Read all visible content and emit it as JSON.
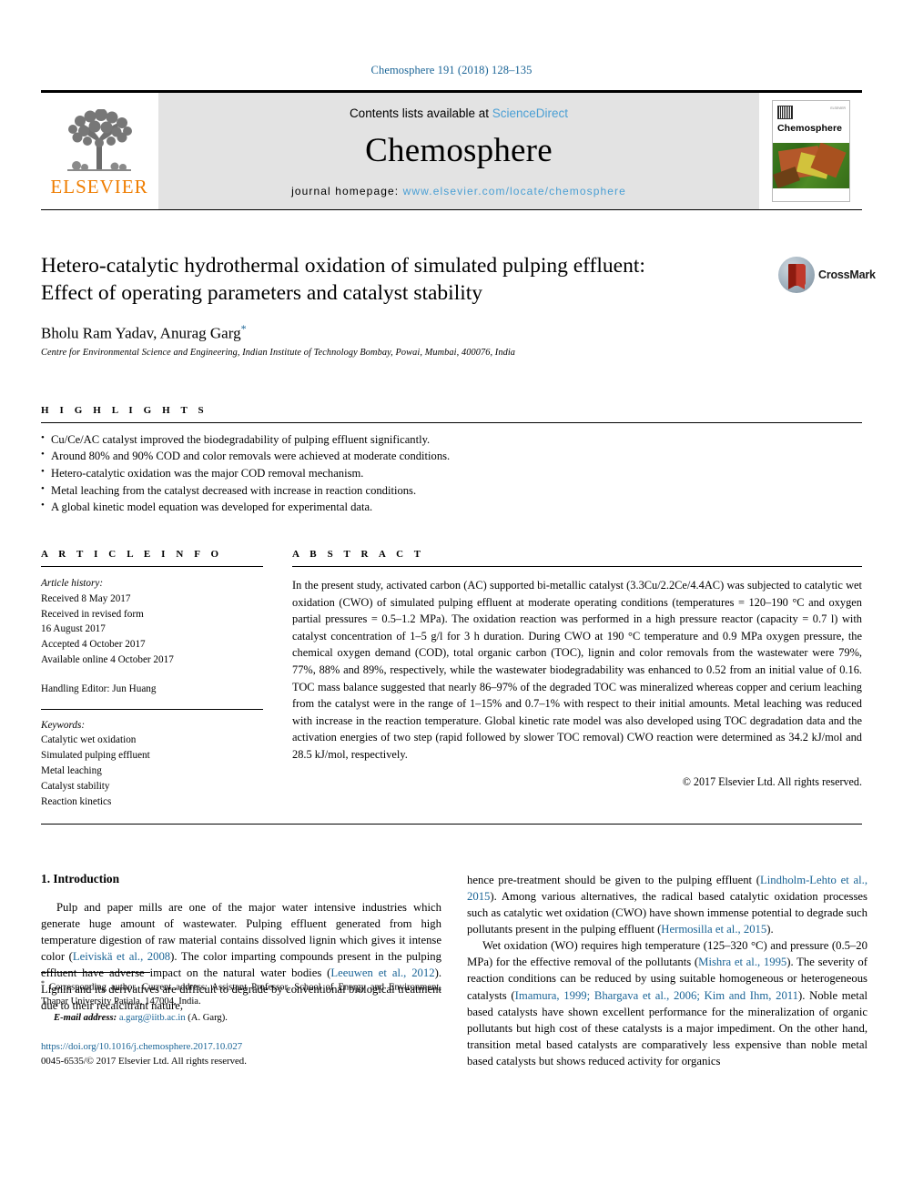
{
  "running_head": "Chemosphere 191 (2018) 128–135",
  "masthead": {
    "publisher_name": "ELSEVIER",
    "contents_prefix": "Contents lists available at ",
    "contents_link": "ScienceDirect",
    "journal_name": "Chemosphere",
    "homepage_prefix": "journal homepage: ",
    "homepage_url": "www.elsevier.com/locate/chemosphere",
    "cover": {
      "title": "Chemosphere",
      "brand": "ELSEVIER"
    }
  },
  "article": {
    "title": "Hetero-catalytic hydrothermal oxidation of simulated pulping effluent: Effect of operating parameters and catalyst stability",
    "authors": "Bholu Ram Yadav, Anurag Garg",
    "corresponding_marker": "*",
    "affiliation": "Centre for Environmental Science and Engineering, Indian Institute of Technology Bombay, Powai, Mumbai, 400076, India",
    "crossmark_label": "CrossMark"
  },
  "highlights": {
    "heading": "H I G H L I G H T S",
    "items": [
      "Cu/Ce/AC catalyst improved the biodegradability of pulping effluent significantly.",
      "Around 80% and 90% COD and color removals were achieved at moderate conditions.",
      "Hetero-catalytic oxidation was the major COD removal mechanism.",
      "Metal leaching from the catalyst decreased with increase in reaction conditions.",
      "A global kinetic model equation was developed for experimental data."
    ]
  },
  "article_info": {
    "heading": "A R T I C L E   I N F O",
    "history_label": "Article history:",
    "history": [
      "Received 8 May 2017",
      "Received in revised form",
      "16 August 2017",
      "Accepted 4 October 2017",
      "Available online 4 October 2017"
    ],
    "handling_editor": "Handling Editor: Jun Huang",
    "keywords_label": "Keywords:",
    "keywords": [
      "Catalytic wet oxidation",
      "Simulated pulping effluent",
      "Metal leaching",
      "Catalyst stability",
      "Reaction kinetics"
    ]
  },
  "abstract": {
    "heading": "A B S T R A C T",
    "text": "In the present study, activated carbon (AC) supported bi-metallic catalyst (3.3Cu/2.2Ce/4.4AC) was subjected to catalytic wet oxidation (CWO) of simulated pulping effluent at moderate operating conditions (temperatures = 120–190 °C and oxygen partial pressures = 0.5–1.2 MPa). The oxidation reaction was performed in a high pressure reactor (capacity = 0.7 l) with catalyst concentration of 1–5 g/l for 3 h duration. During CWO at 190 °C temperature and 0.9 MPa oxygen pressure, the chemical oxygen demand (COD), total organic carbon (TOC), lignin and color removals from the wastewater were 79%, 77%, 88% and 89%, respectively, while the wastewater biodegradability was enhanced to 0.52 from an initial value of 0.16. TOC mass balance suggested that nearly 86–97% of the degraded TOC was mineralized whereas copper and cerium leaching from the catalyst were in the range of 1–15% and 0.7–1% with respect to their initial amounts. Metal leaching was reduced with increase in the reaction temperature. Global kinetic rate model was also developed using TOC degradation data and the activation energies of two step (rapid followed by slower TOC removal) CWO reaction were determined as 34.2 kJ/mol and 28.5 kJ/mol, respectively.",
    "copyright": "© 2017 Elsevier Ltd. All rights reserved."
  },
  "body": {
    "section_heading": "1. Introduction",
    "left_paragraphs": [
      {
        "segments": [
          {
            "t": "Pulp and paper mills are one of the major water intensive industries which generate huge amount of wastewater. Pulping effluent generated from high temperature digestion of raw material contains dissolved lignin which gives it intense color (",
            "link": false
          },
          {
            "t": "Leiviskä et al., 2008",
            "link": true
          },
          {
            "t": "). The color imparting compounds present in the pulping effluent have adverse impact on the natural water bodies (",
            "link": false
          },
          {
            "t": "Leeuwen et al., 2012",
            "link": true
          },
          {
            "t": "). Lignin and its derivatives are difficult to degrade by conventional biological treatment due to their recalcitrant nature,",
            "link": false
          }
        ]
      }
    ],
    "right_paragraphs": [
      {
        "indent": false,
        "segments": [
          {
            "t": "hence pre-treatment should be given to the pulping effluent (",
            "link": false
          },
          {
            "t": "Lindholm-Lehto et al., 2015",
            "link": true
          },
          {
            "t": "). Among various alternatives, the radical based catalytic oxidation processes such as catalytic wet oxidation (CWO) have shown immense potential to degrade such pollutants present in the pulping effluent (",
            "link": false
          },
          {
            "t": "Hermosilla et al., 2015",
            "link": true
          },
          {
            "t": ").",
            "link": false
          }
        ]
      },
      {
        "indent": true,
        "segments": [
          {
            "t": "Wet oxidation (WO) requires high temperature (125–320 °C) and pressure (0.5–20 MPa) for the effective removal of the pollutants (",
            "link": false
          },
          {
            "t": "Mishra et al., 1995",
            "link": true
          },
          {
            "t": "). The severity of reaction conditions can be reduced by using suitable homogeneous or heterogeneous catalysts (",
            "link": false
          },
          {
            "t": "Imamura, 1999; Bhargava et al., 2006; Kim and Ihm, 2011",
            "link": true
          },
          {
            "t": "). Noble metal based catalysts have shown excellent performance for the mineralization of organic pollutants but high cost of these catalysts is a major impediment. On the other hand, transition metal based catalysts are comparatively less expensive than noble metal based catalysts but shows reduced activity for organics",
            "link": false
          }
        ]
      }
    ]
  },
  "footnote": {
    "corresponding_marker": "*",
    "corresponding": " Corresponding author. Current address: Assistant Professor, School of Energy and Environment, Thapar University Patiala, 147004, India.",
    "email_label": "E-mail address:",
    "email": "a.garg@iitb.ac.in",
    "email_suffix": " (A. Garg).",
    "doi": "https://doi.org/10.1016/j.chemosphere.2017.10.027",
    "issn_line": "0045-6535/© 2017 Elsevier Ltd. All rights reserved."
  },
  "colors": {
    "link": "#1a6496",
    "elsevier_orange": "#ef7d00",
    "sciencedirect_blue": "#4a9fd4"
  }
}
